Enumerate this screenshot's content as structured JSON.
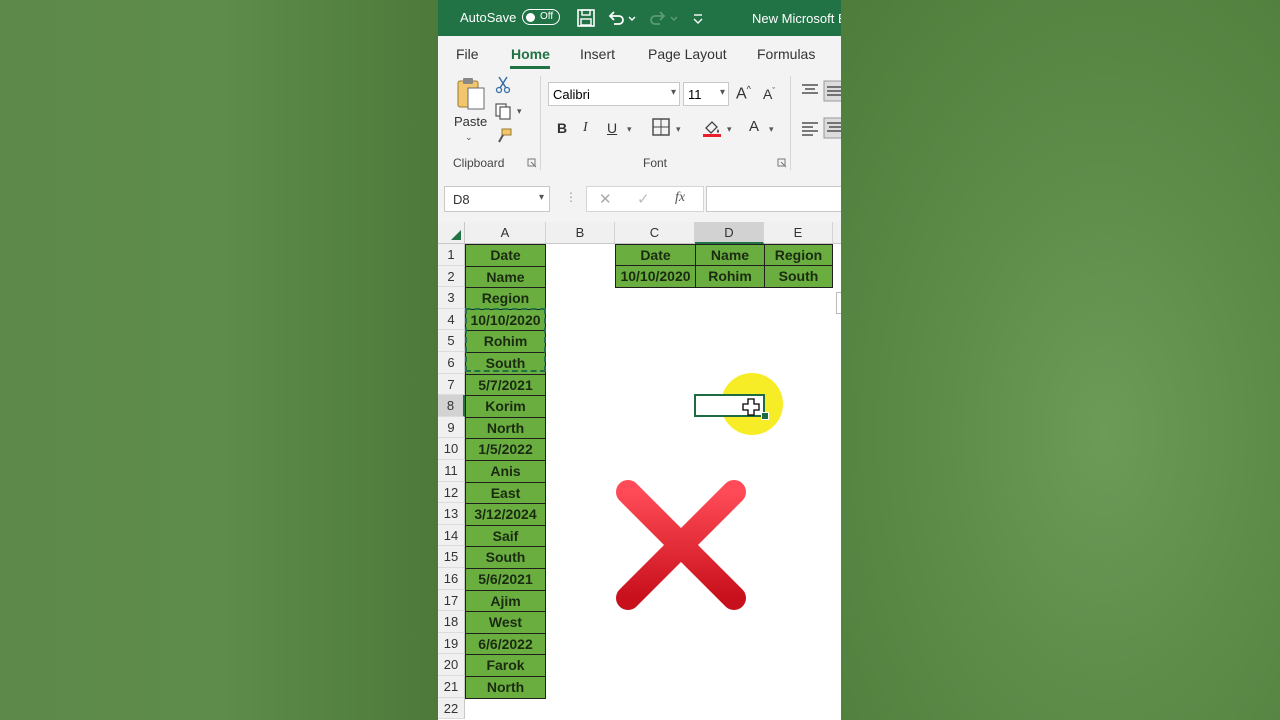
{
  "title_bar": {
    "autosave_label": "AutoSave",
    "autosave_state": "Off",
    "document_title": "New Microsoft E"
  },
  "tabs": [
    {
      "label": "File"
    },
    {
      "label": "Home"
    },
    {
      "label": "Insert"
    },
    {
      "label": "Page Layout"
    },
    {
      "label": "Formulas"
    }
  ],
  "ribbon": {
    "clipboard": {
      "paste_label": "Paste",
      "group_label": "Clipboard"
    },
    "font": {
      "font_name": "Calibri",
      "font_size": "11",
      "group_label": "Font",
      "bold": "B",
      "italic": "I",
      "underline": "U",
      "grow": "A",
      "shrink": "A",
      "font_color": "A"
    }
  },
  "formula_bar": {
    "name_box": "D8",
    "fx_label": "fx",
    "formula": ""
  },
  "grid": {
    "columns": [
      {
        "label": "A"
      },
      {
        "label": "B"
      },
      {
        "label": "C"
      },
      {
        "label": "D"
      },
      {
        "label": "E"
      }
    ],
    "rows": [
      "1",
      "2",
      "3",
      "4",
      "5",
      "6",
      "7",
      "8",
      "9",
      "10",
      "11",
      "12",
      "13",
      "14",
      "15",
      "16",
      "17",
      "18",
      "19",
      "20",
      "21",
      "22"
    ],
    "column_a": [
      "Date",
      "Name",
      "Region",
      "10/10/2020",
      "Rohim",
      "South",
      "5/7/2021",
      "Korim",
      "North",
      "1/5/2022",
      "Anis",
      "East",
      "3/12/2024",
      "Saif",
      "South",
      "5/6/2021",
      "Ajim",
      "West",
      "6/6/2022",
      "Farok",
      "North"
    ],
    "table": {
      "headers": [
        "Date",
        "Name",
        "Region"
      ],
      "row": [
        "10/10/2020",
        "Rohim",
        "South"
      ]
    },
    "selected_cell": "D8",
    "selected_column": "D",
    "selected_row": "8"
  },
  "colors": {
    "excel_green": "#217346",
    "cell_fill": "#6aae3f",
    "highlight": "#f5ec1a",
    "x_mark": "#e8202c"
  }
}
